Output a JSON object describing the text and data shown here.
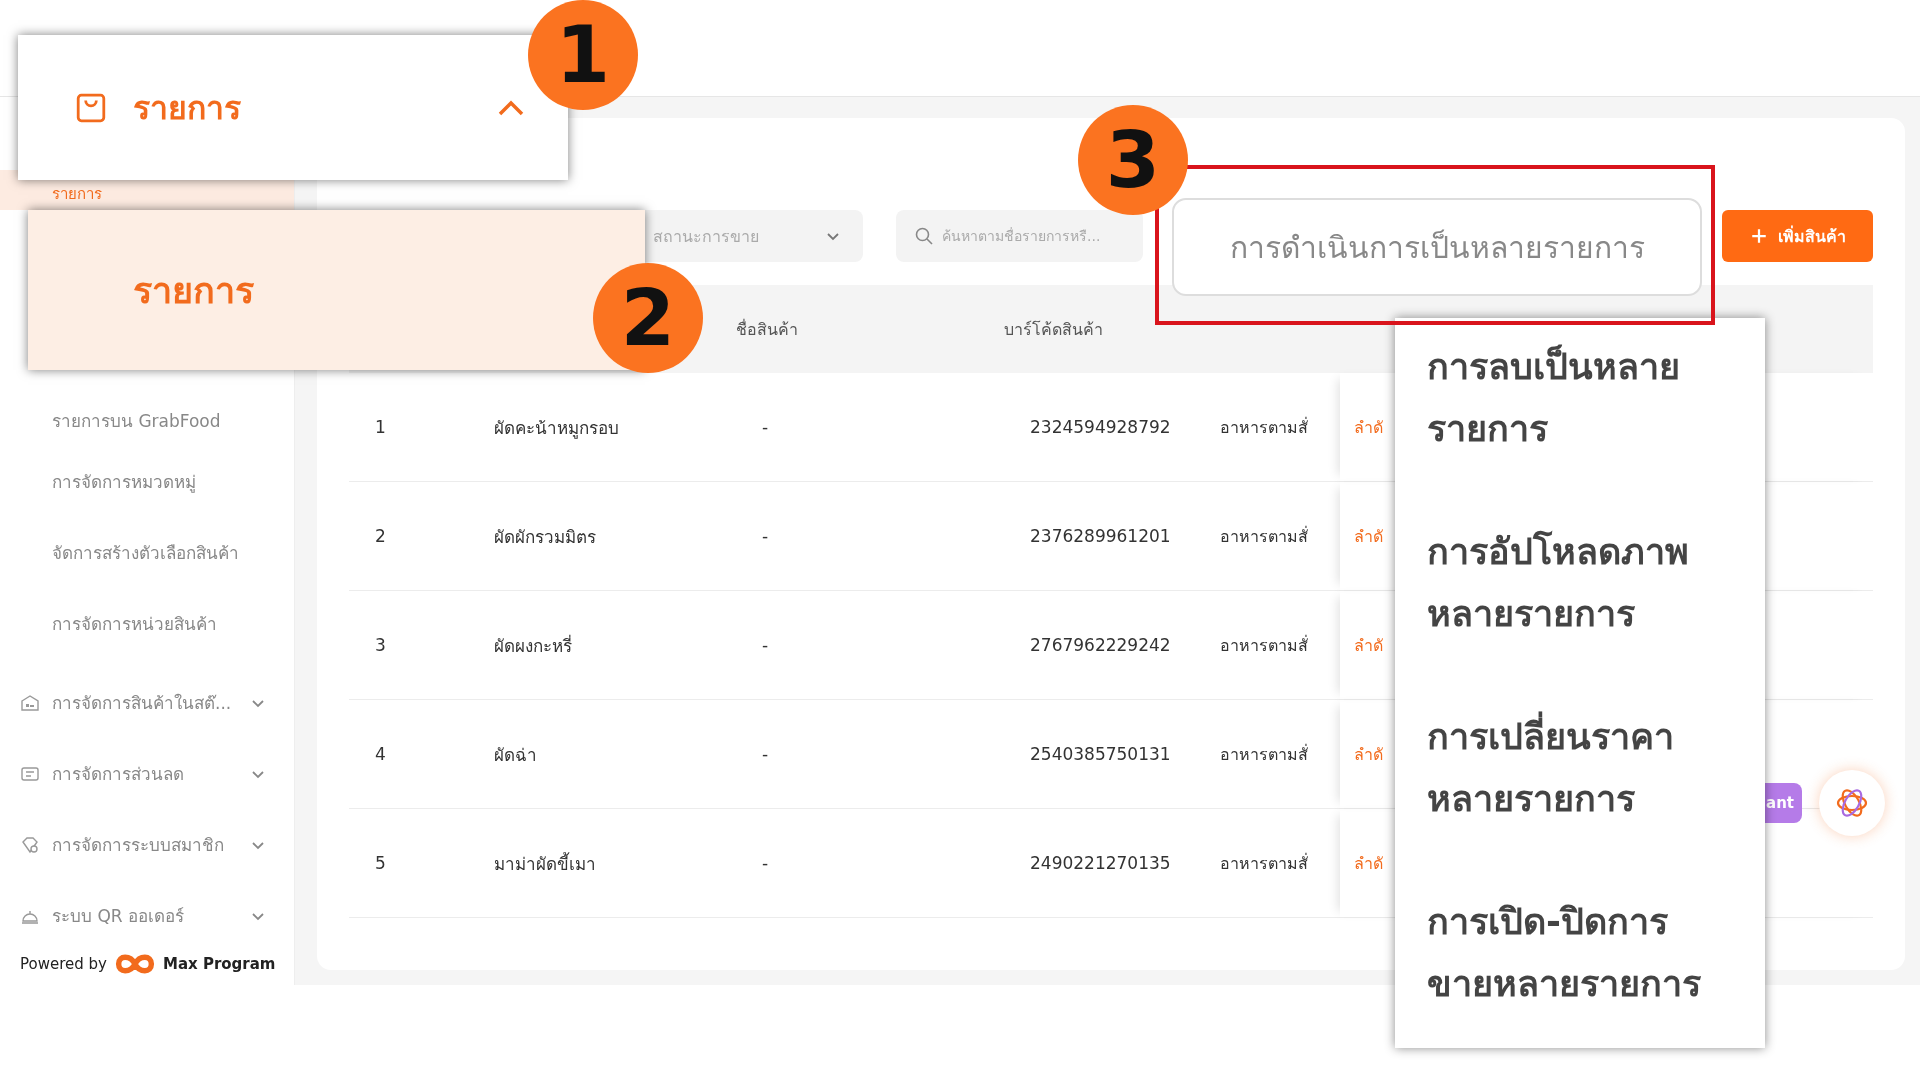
{
  "callouts": {
    "menu_header": {
      "label": "รายการ",
      "expanded": true
    },
    "active_item": {
      "label": "รายการ"
    },
    "bulk_action": {
      "label": "การดำเนินการเป็นหลายรายการ"
    },
    "badges": [
      "1",
      "2",
      "3"
    ]
  },
  "sidebar": {
    "items": [
      {
        "label": "รายการ",
        "selected": true
      },
      {
        "label": "รายการบน GrabFood",
        "selected": false
      },
      {
        "label": "การจัดการหมวดหมู่",
        "selected": false
      },
      {
        "label": "จัดการสร้างตัวเลือกสินค้า",
        "selected": false
      },
      {
        "label": "การจัดการหน่วยสินค้า",
        "selected": false
      }
    ],
    "groups": [
      {
        "label": "การจัดการสินค้าในสต๊...",
        "expanded": false
      },
      {
        "label": "การจัดการส่วนลด",
        "expanded": false
      },
      {
        "label": "การจัดการระบบสมาชิก",
        "expanded": false
      },
      {
        "label": "ระบบ QR ออเดอร์",
        "expanded": false
      }
    ],
    "footer": {
      "powered_by": "Powered by",
      "brand": "Max Program"
    }
  },
  "filters": {
    "status_select": {
      "placeholder": "สถานะการขาย"
    },
    "search": {
      "placeholder": "ค้นหาตามชื่อรายการหรื..."
    },
    "add_button": "เพิ่มสินค้า"
  },
  "table": {
    "columns": {
      "product_name": "ชื่อสินค้า",
      "barcode": "บาร์โค้ดสินค้า"
    },
    "rows": [
      {
        "no": "1",
        "item": "ผัดคะน้าหมูกรอบ",
        "product_name": "-",
        "barcode": "2324594928792",
        "category": "อาหารตามสั่",
        "action": "ลำดั"
      },
      {
        "no": "2",
        "item": "ผัดผักรวมมิตร",
        "product_name": "-",
        "barcode": "2376289961201",
        "category": "อาหารตามสั่",
        "action": "ลำดั"
      },
      {
        "no": "3",
        "item": "ผัดผงกะหรี่",
        "product_name": "-",
        "barcode": "2767962229242",
        "category": "อาหารตามสั่",
        "action": "ลำดั"
      },
      {
        "no": "4",
        "item": "ผัดฉ่า",
        "product_name": "-",
        "barcode": "2540385750131",
        "category": "อาหารตามสั่",
        "action": "ลำดั"
      },
      {
        "no": "5",
        "item": "มาม่าผัดขี้เมา",
        "product_name": "-",
        "barcode": "2490221270135",
        "category": "อาหารตามสั่",
        "action": "ลำดั"
      }
    ]
  },
  "bulk_menu": {
    "items": [
      "การลบเป็นหลายรายการ",
      "การอัปโหลดภาพหลายรายการ",
      "การเปลี่ยนราคาหลายรายการ",
      "การเปิด-ปิดการขายหลายรายการ"
    ]
  },
  "assistant": {
    "label": "ant"
  }
}
